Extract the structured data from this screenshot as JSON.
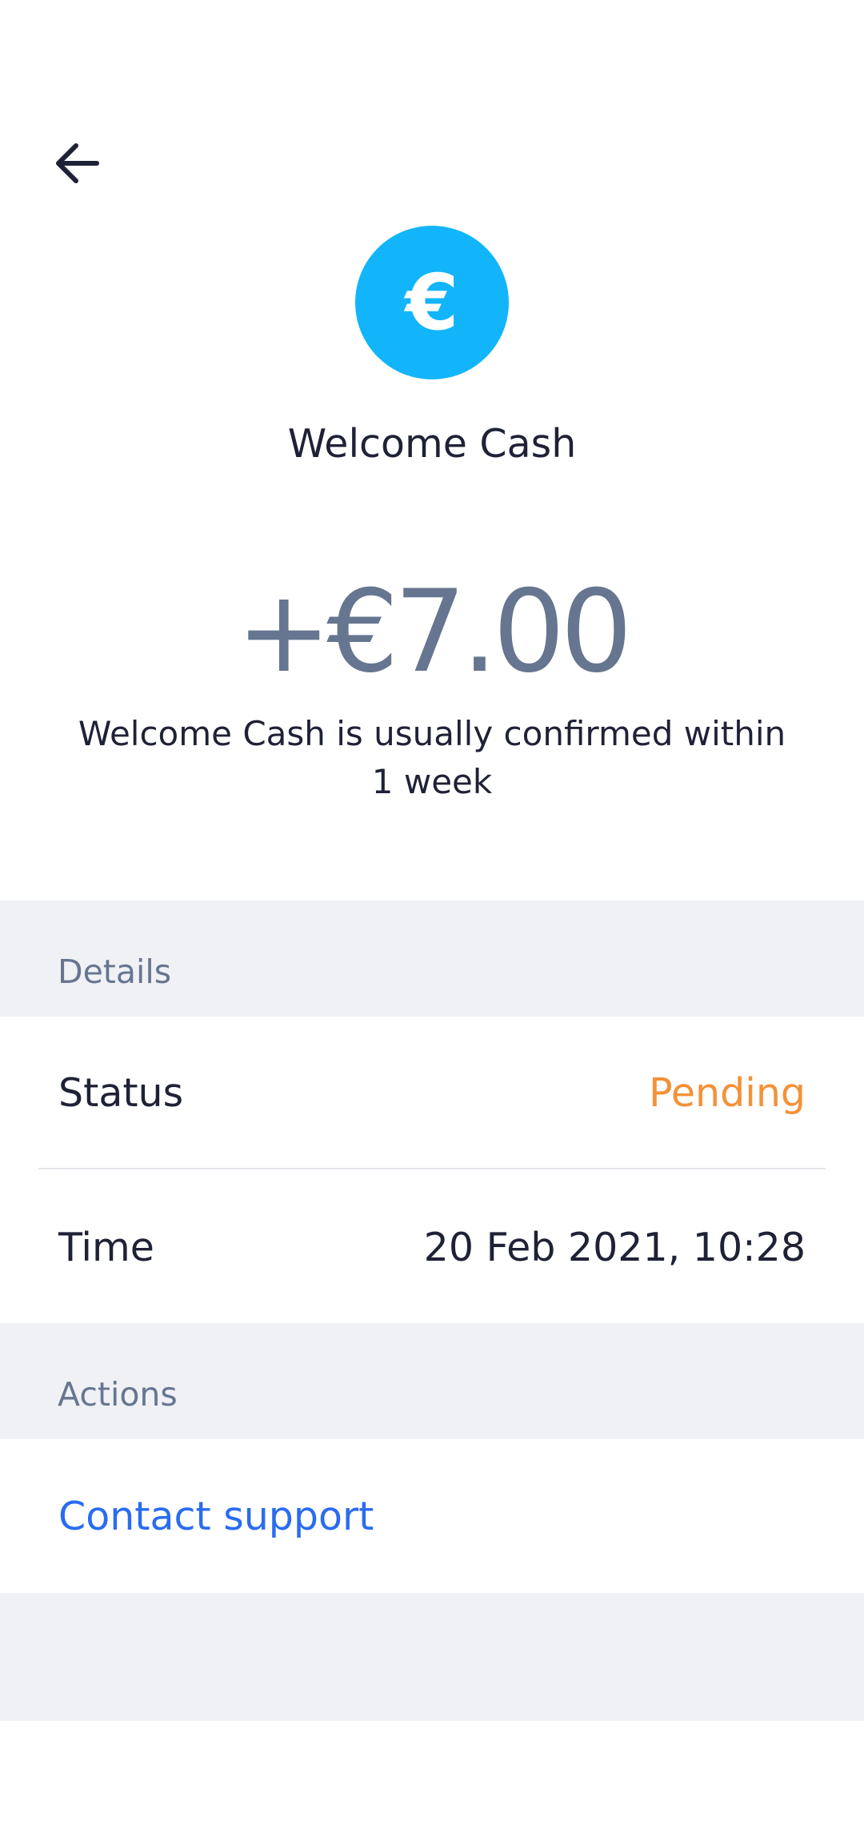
{
  "header": {
    "back_icon": "arrow-left-icon"
  },
  "badge": {
    "icon": "euro-icon",
    "glyph": "€",
    "color": "#13b5fa"
  },
  "title": "Welcome Cash",
  "amount": "+€7.00",
  "subtitle": "Welcome Cash is usually confirmed within 1 week",
  "details": {
    "header": "Details",
    "status_label": "Status",
    "status_value": "Pending",
    "status_color": "#f49137",
    "time_label": "Time",
    "time_value": "20 Feb 2021, 10:28"
  },
  "actions": {
    "header": "Actions",
    "contact_support": "Contact support",
    "link_color": "#2a6cf0"
  }
}
